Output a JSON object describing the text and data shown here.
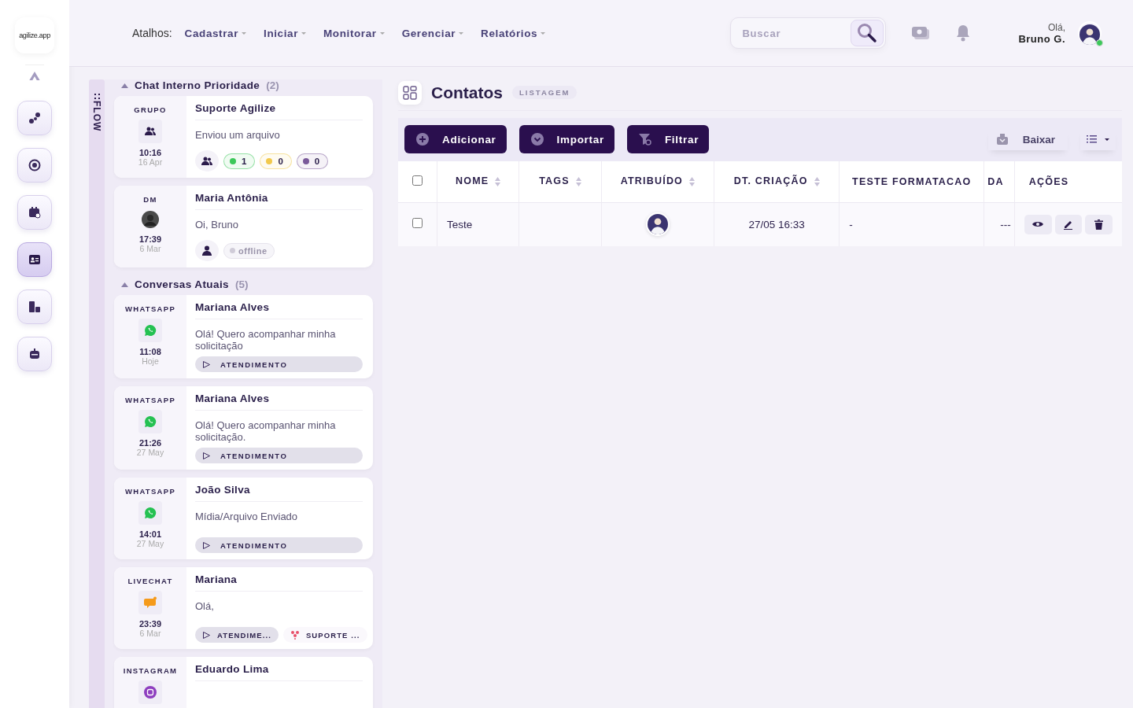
{
  "logo": {
    "text": "agilize.app"
  },
  "shortcuts": {
    "label": "Atalhos:",
    "menus": [
      "Cadastrar",
      "Iniciar",
      "Monitorar",
      "Gerenciar",
      "Relatórios"
    ]
  },
  "search": {
    "placeholder": "Buscar"
  },
  "user": {
    "greeting": "Olá,",
    "name": "Bruno G.",
    "online": true
  },
  "rail": [
    {
      "kind": "share",
      "selected": false
    },
    {
      "kind": "gauge",
      "selected": false
    },
    {
      "kind": "calendar",
      "selected": false
    },
    {
      "kind": "contact",
      "selected": true
    },
    {
      "kind": "building",
      "selected": false
    },
    {
      "kind": "robot",
      "selected": false
    }
  ],
  "flow": {
    "label": "FLOW",
    "groups": [
      {
        "title": "Chat Interno Prioridade",
        "count": "(2)",
        "expanded": true,
        "conversations": [
          {
            "kind": "group",
            "channel": "GRUPO",
            "time": "10:16",
            "date": "16 Apr",
            "name": "Suporte Agilize",
            "preview": "Enviou um arquivo",
            "counters": [
              {
                "value": "1",
                "color": "#3cc85a"
              },
              {
                "value": "0",
                "color": "#f2c94c"
              },
              {
                "value": "0",
                "color": "#7a5a9a"
              }
            ]
          },
          {
            "kind": "dm",
            "channel": "DM",
            "time": "17:39",
            "date": "6 Mar",
            "name": "Maria Antônia",
            "preview": "Oi, Bruno",
            "status": "offline"
          }
        ]
      },
      {
        "title": "Conversas Atuais",
        "count": "(5)",
        "expanded": true,
        "conversations": [
          {
            "kind": "whatsapp",
            "channel": "WHATSAPP",
            "time": "11:08",
            "date": "Hoje",
            "name": "Mariana Alves",
            "preview": "Olá! Quero acompanhar minha solicitação",
            "tags": [
              {
                "kind": "status",
                "label": "ATENDIMENTO"
              }
            ]
          },
          {
            "kind": "whatsapp",
            "channel": "WHATSAPP",
            "time": "21:26",
            "date": "27 May",
            "name": "Mariana Alves",
            "preview": "Olá! Quero acompanhar minha solicitação.",
            "tags": [
              {
                "kind": "status",
                "label": "ATENDIMENTO"
              }
            ]
          },
          {
            "kind": "whatsapp",
            "channel": "WHATSAPP",
            "time": "14:01",
            "date": "27 May",
            "name": "João Silva",
            "preview": "Mídia/Arquivo Enviado",
            "tags": [
              {
                "kind": "status",
                "label": "ATENDIMENTO"
              }
            ]
          },
          {
            "kind": "livechat",
            "channel": "LIVECHAT",
            "time": "23:39",
            "date": "6 Mar",
            "name": "Mariana",
            "preview": "Olá,",
            "tags": [
              {
                "kind": "status",
                "label": "ATENDIME..."
              },
              {
                "kind": "team",
                "label": "SUPORTE ..."
              }
            ]
          },
          {
            "kind": "instagram",
            "channel": "INSTAGRAM",
            "name": "Eduardo Lima"
          }
        ]
      }
    ]
  },
  "page": {
    "title": "Contatos",
    "badge": "LISTAGEM"
  },
  "toolbar": {
    "buttons": [
      {
        "kind": "add",
        "label": "Adicionar"
      },
      {
        "kind": "import",
        "label": "Importar"
      },
      {
        "kind": "filter",
        "label": "Filtrar"
      }
    ],
    "download": "Baixar"
  },
  "table": {
    "select_all": {
      "checked": false
    },
    "columns": [
      {
        "label": "NOME",
        "sortable": true
      },
      {
        "label": "TAGS",
        "sortable": true
      },
      {
        "label": "ATRIBUÍDO",
        "sortable": true
      },
      {
        "label": "DT. CRIAÇÃO",
        "sortable": true
      },
      {
        "label": "TESTE FORMATACAO",
        "sortable": false
      },
      {
        "label": "DA",
        "sortable": false
      },
      {
        "label": "AÇÕES",
        "sortable": false
      }
    ],
    "rows": [
      {
        "checked": false,
        "nome": "Teste",
        "criacao": "27/05 16:33",
        "teste_formatacao": "-",
        "da": "---"
      }
    ]
  }
}
